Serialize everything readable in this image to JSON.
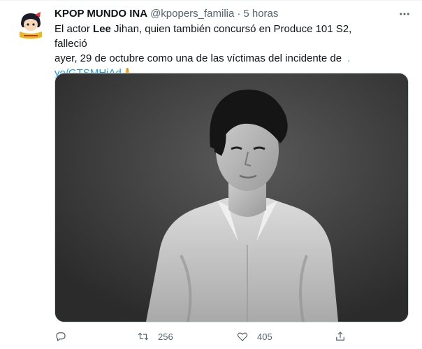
{
  "author": {
    "name": "KPOP MUNDO INA",
    "handle": "@kpopers_familia",
    "time_separator": "·",
    "time": "5 horas"
  },
  "tweet": {
    "line1_pre": "El actor ",
    "line1_bold": "Lee",
    "line1_post": " Jihan, quien también concursó en Produce 101 S2, falleció",
    "line2": "ayer, 29 de octubre como una de las víctimas del incidente de",
    "line2_link": ".",
    "line3_link": "yo/GTSMHjAd",
    "line3_emoji": "🙏"
  },
  "actions": {
    "reply_count": "",
    "retweet_count": "256",
    "like_count": "405"
  },
  "icons": {
    "more": "more-dots-icon",
    "reply": "reply-icon",
    "retweet": "retweet-icon",
    "like": "heart-icon",
    "share": "share-icon"
  },
  "colors": {
    "link": "#1d9bf0",
    "secondary": "#536471",
    "photo_bg": "#3a3a3a"
  }
}
